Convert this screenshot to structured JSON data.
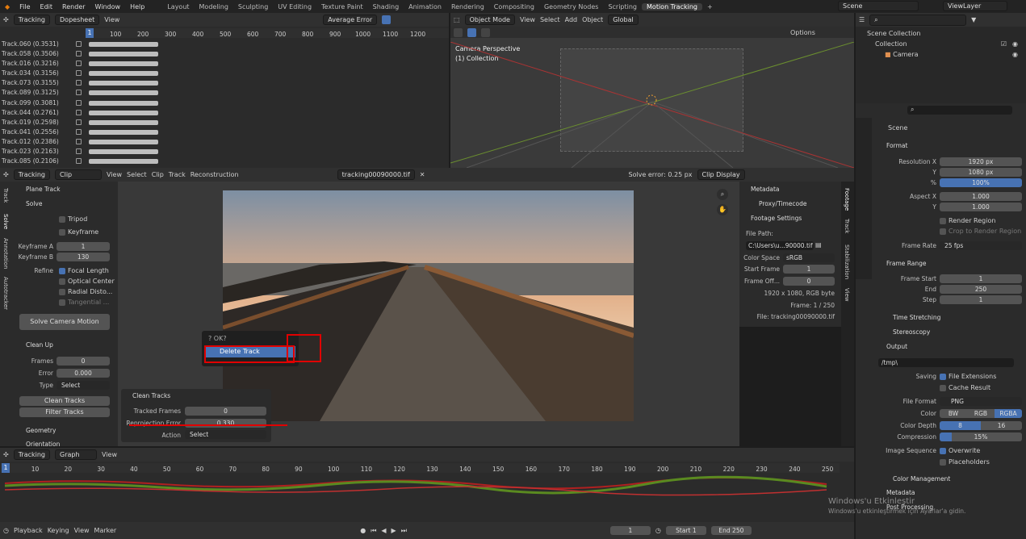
{
  "menu": [
    "File",
    "Edit",
    "Render",
    "Window",
    "Help"
  ],
  "workspaces": [
    "Layout",
    "Modeling",
    "Sculpting",
    "UV Editing",
    "Texture Paint",
    "Shading",
    "Animation",
    "Rendering",
    "Compositing",
    "Geometry Nodes",
    "Scripting",
    "Motion Tracking"
  ],
  "scene": "Scene",
  "view_layer": "ViewLayer",
  "dopesheet": {
    "editor": "Tracking",
    "mode": "Dopesheet",
    "view": "View",
    "sort": "Average Error",
    "ticks": [
      "1",
      "100",
      "200",
      "300",
      "400",
      "500",
      "600",
      "700",
      "800",
      "900",
      "1000",
      "1100",
      "1200"
    ],
    "tracks": [
      "Track.060 (0.3531)",
      "Track.058 (0.3506)",
      "Track.016 (0.3216)",
      "Track.034 (0.3156)",
      "Track.073 (0.3155)",
      "Track.089 (0.3125)",
      "Track.099 (0.3081)",
      "Track.044 (0.2761)",
      "Track.019 (0.2598)",
      "Track.041 (0.2556)",
      "Track.012 (0.2386)",
      "Track.023 (0.2163)",
      "Track.085 (0.2106)"
    ]
  },
  "viewport": {
    "mode": "Object Mode",
    "view": "View",
    "select": "Select",
    "add": "Add",
    "object": "Object",
    "orient": "Global",
    "options": "Options",
    "cam": "Camera Perspective",
    "coll": "(1) Collection"
  },
  "outliner": {
    "scene_collection": "Scene Collection",
    "collection": "Collection",
    "camera": "Camera"
  },
  "clip": {
    "editor": "Tracking",
    "mode": "Clip",
    "menus": [
      "View",
      "Select",
      "Clip",
      "Track",
      "Reconstruction"
    ],
    "file": "tracking00090000.tif",
    "solve_error": "Solve error: 0.25 px",
    "display": "Clip Display"
  },
  "left_panel": {
    "plane_track": "Plane Track",
    "solve": "Solve",
    "tripod": "Tripod",
    "keyframe": "Keyframe",
    "kfa_lbl": "Keyframe A",
    "kfa": "1",
    "kfb_lbl": "Keyframe B",
    "kfb": "130",
    "refine": "Refine",
    "focal": "Focal Length",
    "optical": "Optical Center",
    "radial": "Radial Disto...",
    "tangential": "Tangential ...",
    "solve_btn": "Solve Camera Motion",
    "cleanup": "Clean Up",
    "frames_lbl": "Frames",
    "frames": "0",
    "error_lbl": "Error",
    "error": "0.000",
    "type_lbl": "Type",
    "type": "Select",
    "clean_btn": "Clean Tracks",
    "filter_btn": "Filter Tracks",
    "geometry": "Geometry",
    "orientation": "Orientation"
  },
  "vtabs": [
    "Track",
    "Solve",
    "Annotation",
    "Autotracker"
  ],
  "right_vtabs": [
    "Footage",
    "Track",
    "Stabilization",
    "View"
  ],
  "popup": {
    "title": "OK?",
    "item": "Delete Track"
  },
  "operator": {
    "title": "Clean Tracks",
    "tf_lbl": "Tracked Frames",
    "tf": "0",
    "re_lbl": "Reprojection Error",
    "re": "0.330",
    "act_lbl": "Action",
    "act": "Select"
  },
  "footage": {
    "metadata": "Metadata",
    "proxy": "Proxy/Timecode",
    "settings": "Footage Settings",
    "path_lbl": "File Path:",
    "path": "C:\\Users\\u...90000.tif",
    "cs_lbl": "Color Space",
    "cs": "sRGB",
    "sf_lbl": "Start Frame",
    "sf": "1",
    "fo_lbl": "Frame Off...",
    "fo": "0",
    "res": "1920 x 1080, RGB byte",
    "frame": "Frame: 1 / 250",
    "file": "File: tracking00090000.tif"
  },
  "props": {
    "scene": "Scene",
    "format": "Format",
    "resx_lbl": "Resolution X",
    "resx": "1920 px",
    "y_lbl": "Y",
    "resy": "1080 px",
    "pct_lbl": "%",
    "pct": "100%",
    "aspx_lbl": "Aspect X",
    "aspx": "1.000",
    "aspy": "1.000",
    "render_region": "Render Region",
    "crop": "Crop to Render Region",
    "fr_lbl": "Frame Rate",
    "fr": "25 fps",
    "frame_range": "Frame Range",
    "fs_lbl": "Frame Start",
    "fs": "1",
    "end_lbl": "End",
    "end": "250",
    "step_lbl": "Step",
    "step": "1",
    "time_stretch": "Time Stretching",
    "stereo": "Stereoscopy",
    "output": "Output",
    "path": "/tmp\\",
    "saving": "Saving",
    "ext": "File Extensions",
    "cache": "Cache Result",
    "ff_lbl": "File Format",
    "ff": "PNG",
    "color_lbl": "Color",
    "bw": "BW",
    "rgb": "RGB",
    "rgba": "RGBA",
    "depth_lbl": "Color Depth",
    "d8": "8",
    "d16": "16",
    "comp_lbl": "Compression",
    "comp": "15%",
    "comp_val": 0.15,
    "seq_lbl": "Image Sequence",
    "overwrite": "Overwrite",
    "placeholders": "Placeholders",
    "colman": "Color Management",
    "metadata": "Metadata",
    "post": "Post Processing"
  },
  "graph": {
    "editor": "Tracking",
    "mode": "Graph",
    "view": "View",
    "ticks": [
      "1",
      "10",
      "20",
      "30",
      "40",
      "50",
      "60",
      "70",
      "80",
      "90",
      "100",
      "110",
      "120",
      "130",
      "140",
      "150",
      "160",
      "170",
      "180",
      "190",
      "200",
      "210",
      "220",
      "230",
      "240",
      "250"
    ]
  },
  "timeline": {
    "playback": "Playback",
    "keying": "Keying",
    "view": "View",
    "marker": "Marker",
    "current": "1",
    "start_lbl": "Start",
    "start": "1",
    "end_lbl": "End",
    "end": "250"
  },
  "watermark": {
    "line1": "Windows'u Etkinleştir",
    "line2": "Windows'u etkinleştirmek için Ayarlar'a gidin."
  }
}
